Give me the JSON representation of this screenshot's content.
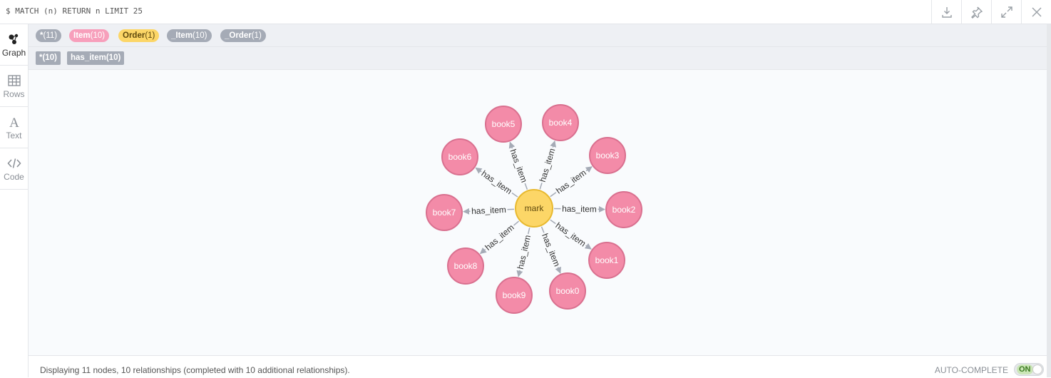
{
  "query": "$ MATCH (n) RETURN n LIMIT 25",
  "top_actions": [
    {
      "name": "download-icon"
    },
    {
      "name": "pin-icon"
    },
    {
      "name": "expand-icon"
    },
    {
      "name": "close-icon"
    }
  ],
  "sidebar": {
    "tabs": [
      {
        "label": "Graph",
        "icon": "graph-icon",
        "active": true
      },
      {
        "label": "Rows",
        "icon": "table-icon",
        "active": false
      },
      {
        "label": "Text",
        "icon": "text-icon",
        "active": false
      },
      {
        "label": "Code",
        "icon": "code-icon",
        "active": false
      }
    ]
  },
  "node_labels": [
    {
      "label": "*",
      "count": "(11)",
      "color": "#a5abb6"
    },
    {
      "label": "Item",
      "count": "(10)",
      "color": "#f79fbb"
    },
    {
      "label": "Order",
      "count": "(1)",
      "color": "#fcd667"
    },
    {
      "label": "_Item",
      "count": "(10)",
      "color": "#a5abb6"
    },
    {
      "label": "_Order",
      "count": "(1)",
      "color": "#a5abb6"
    }
  ],
  "relationship_types": [
    {
      "label": "*(10)"
    },
    {
      "label": "has_item(10)"
    }
  ],
  "graph": {
    "center": {
      "label": "mark",
      "color": "#fcd667",
      "stroke": "#e8b92f"
    },
    "leaf_color": "#f38ba8",
    "leaf_stroke": "#d9708f",
    "relationship": "has_item",
    "leaves": [
      "book5",
      "book4",
      "book6",
      "book3",
      "book7",
      "book2",
      "book8",
      "book1",
      "book9",
      "book0"
    ]
  },
  "footer": {
    "status": "Displaying 11 nodes, 10 relationships (completed with 10 additional relationships).",
    "autocomplete_label": "AUTO-COMPLETE",
    "toggle_label": "ON"
  }
}
